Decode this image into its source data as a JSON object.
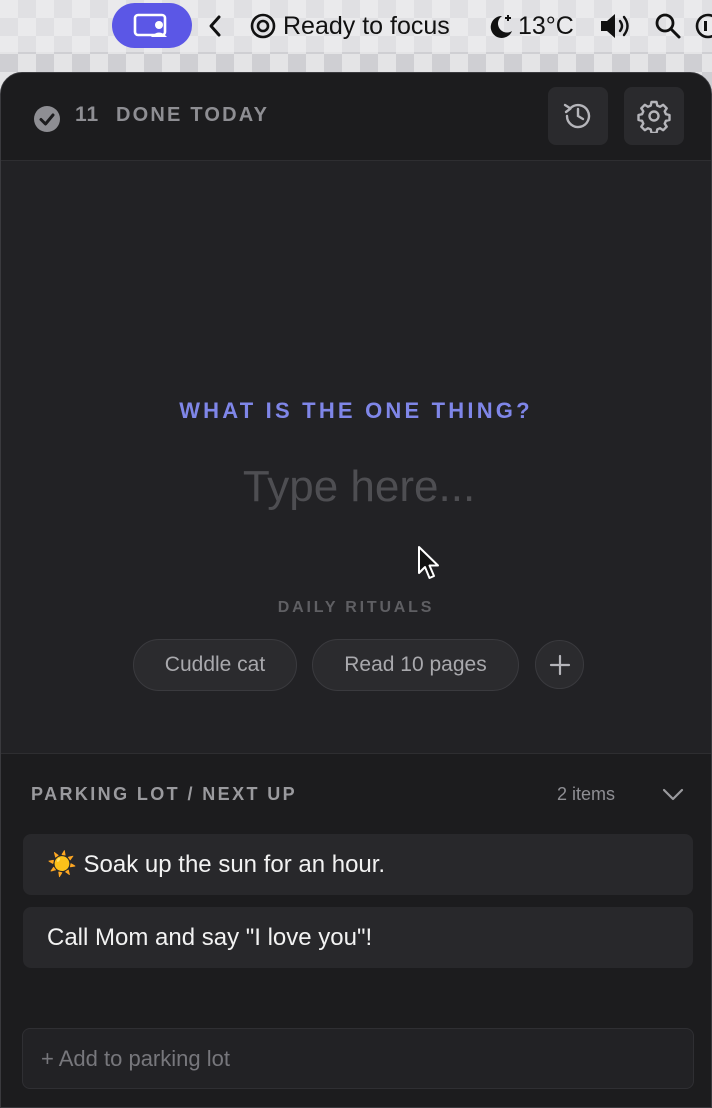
{
  "menubar": {
    "focus_status": "Ready to focus",
    "weather": "13°C",
    "icons": [
      "screen-share-icon",
      "chevron-left-icon",
      "focus-target-icon",
      "moon-weather-icon",
      "volume-icon",
      "search-icon",
      "record-icon"
    ]
  },
  "header": {
    "done_count": "11",
    "done_label": "DONE TODAY"
  },
  "focus": {
    "title": "WHAT IS THE ONE THING?",
    "placeholder": "Type here...",
    "accent_color": "#7f86e8"
  },
  "rituals": {
    "label": "DAILY RITUALS",
    "items": [
      "Cuddle cat",
      "Read 10 pages"
    ]
  },
  "parking_lot": {
    "title": "PARKING LOT / NEXT UP",
    "count": "2 items",
    "items": [
      "☀️ Soak up the sun for an hour.",
      "Call Mom and say \"I love you\"!"
    ],
    "add_placeholder": "+ Add to parking lot"
  }
}
